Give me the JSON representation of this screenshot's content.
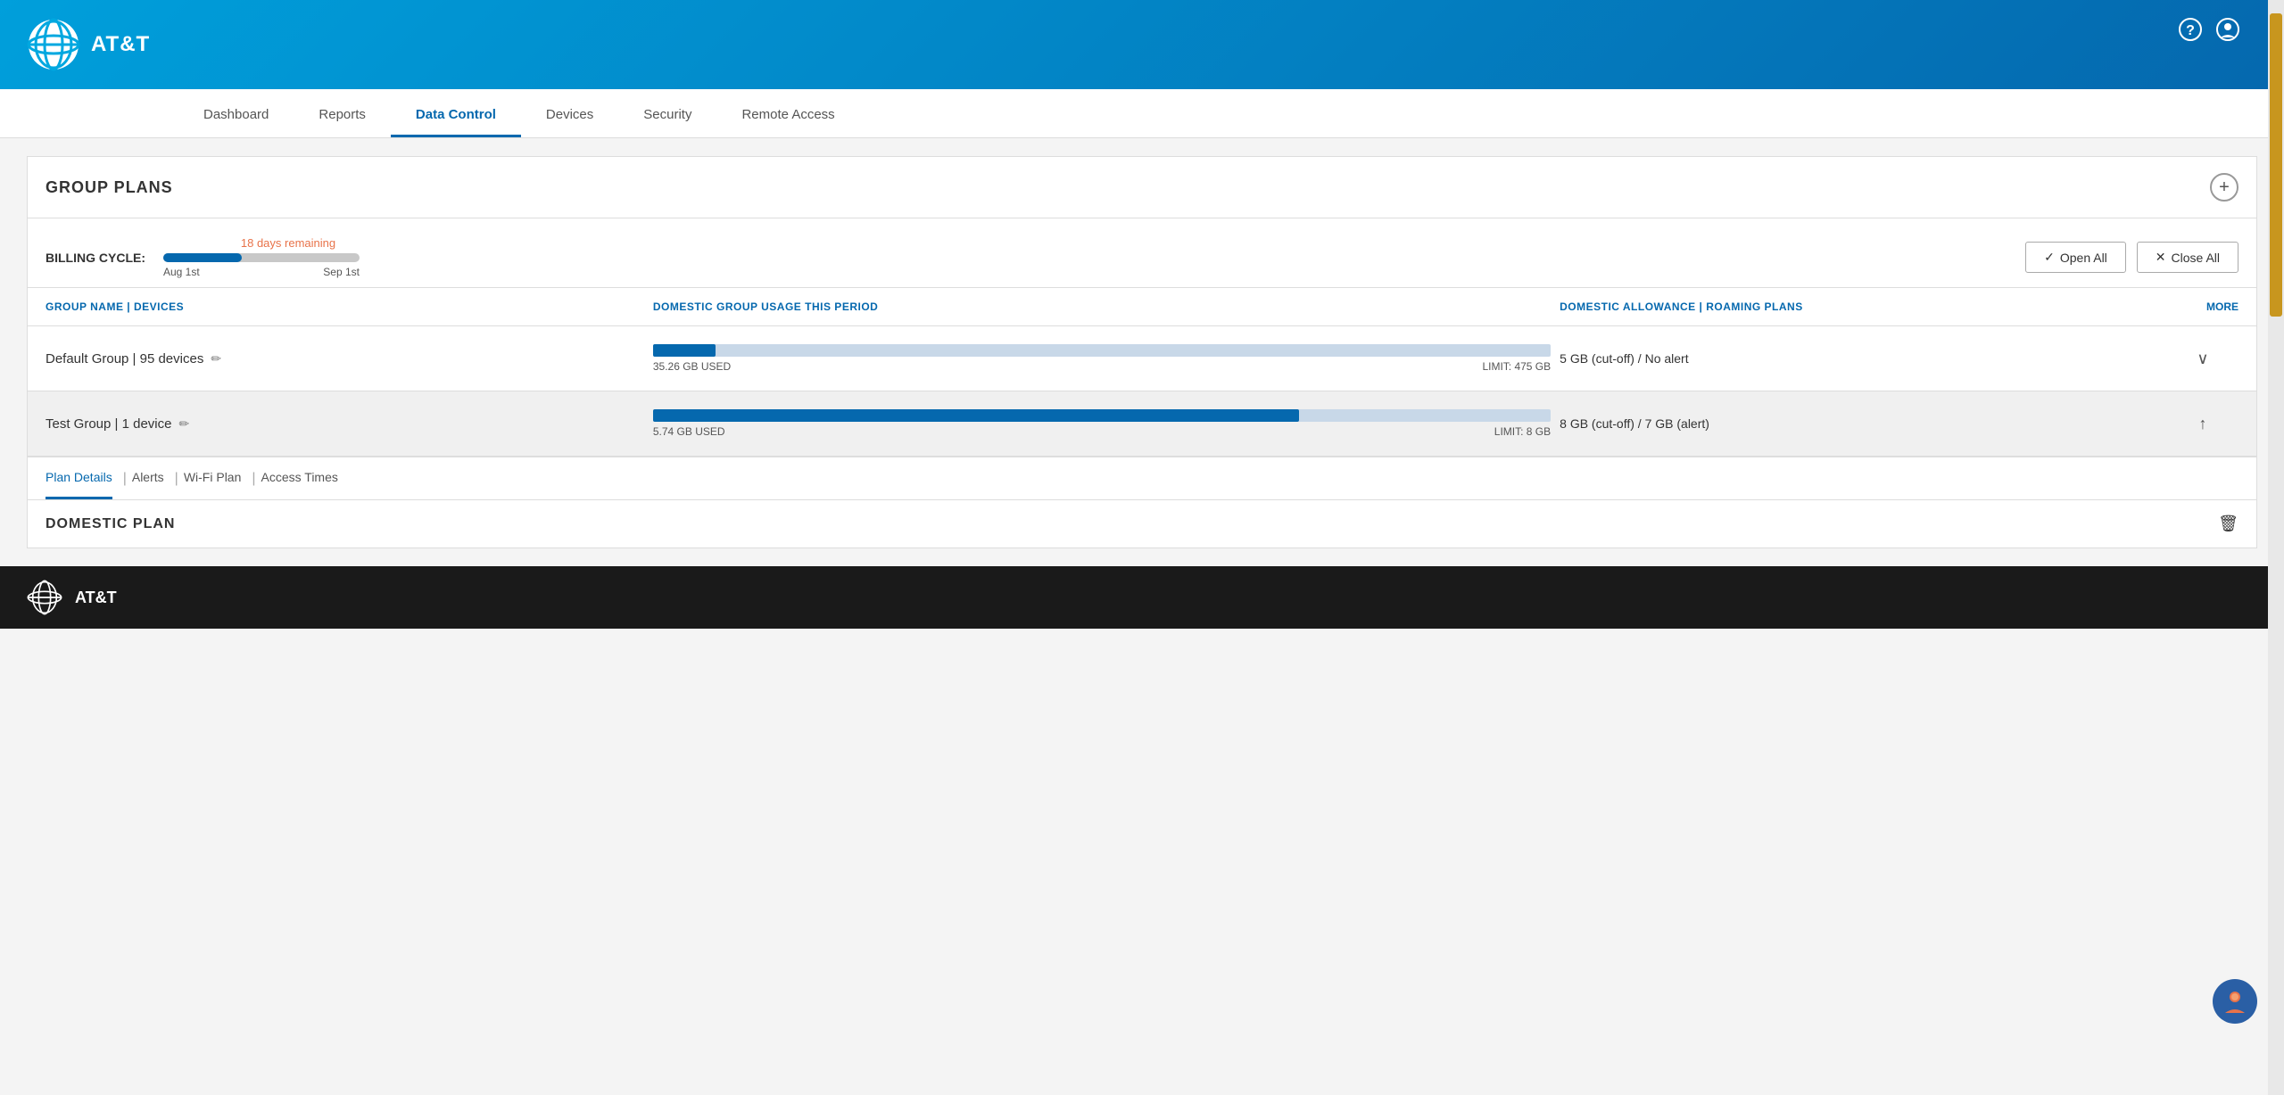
{
  "brand": {
    "name": "AT&T",
    "logo_alt": "AT&T Globe Logo"
  },
  "header": {
    "help_icon": "?",
    "user_icon": "👤"
  },
  "nav": {
    "items": [
      {
        "id": "dashboard",
        "label": "Dashboard",
        "active": false
      },
      {
        "id": "reports",
        "label": "Reports",
        "active": false
      },
      {
        "id": "data-control",
        "label": "Data Control",
        "active": true
      },
      {
        "id": "devices",
        "label": "Devices",
        "active": false
      },
      {
        "id": "security",
        "label": "Security",
        "active": false
      },
      {
        "id": "remote-access",
        "label": "Remote Access",
        "active": false
      }
    ]
  },
  "group_plans": {
    "title": "GROUP PLANS",
    "billing": {
      "label": "BILLING CYCLE:",
      "days_remaining": "18 days remaining",
      "start_date": "Aug 1st",
      "end_date": "Sep 1st",
      "progress_percent": 40
    },
    "actions": {
      "open_all": "Open All",
      "close_all": "Close All"
    },
    "table_headers": {
      "group_name": "GROUP NAME | DEVICES",
      "usage": "DOMESTIC GROUP USAGE THIS PERIOD",
      "allowance": "DOMESTIC ALLOWANCE | ROAMING PLANS",
      "more": "MORE"
    },
    "groups": [
      {
        "id": "default-group",
        "name": "Default Group | 95 devices",
        "usage_gb": "35.26 GB USED",
        "limit": "LIMIT: 475 GB",
        "usage_percent": 7,
        "allowance": "5 GB (cut-off) / No alert",
        "expanded": false
      },
      {
        "id": "test-group",
        "name": "Test Group | 1 device",
        "usage_gb": "5.74 GB USED",
        "limit": "LIMIT: 8 GB",
        "usage_percent": 72,
        "allowance": "8 GB (cut-off) / 7 GB (alert)",
        "expanded": true
      }
    ],
    "plan_details": {
      "tabs": [
        {
          "id": "plan-details",
          "label": "Plan Details",
          "active": true
        },
        {
          "id": "alerts",
          "label": "Alerts",
          "active": false
        },
        {
          "id": "wifi-plan",
          "label": "Wi-Fi Plan",
          "active": false
        },
        {
          "id": "access-times",
          "label": "Access Times",
          "active": false
        }
      ],
      "domestic_plan_title": "DOMESTIC PLAN"
    }
  },
  "footer": {
    "brand": "AT&T"
  }
}
